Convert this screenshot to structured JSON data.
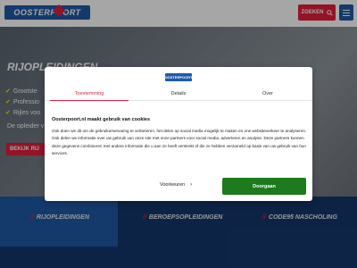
{
  "header": {
    "logo_text": "OOSTERPOORT",
    "search_label": "ZOEKEN"
  },
  "hero": {
    "title": "RIJOPLEIDINGEN",
    "list": [
      "Grootste",
      "Professio",
      "Rijles voo"
    ],
    "text": "De opleider v",
    "button_label": "BEKIJK RIJ"
  },
  "band": {
    "items": [
      "RIJOPLEIDINGEN",
      "BEROEPSOPLEIDINGEN",
      "CODE95 NASCHOLING"
    ]
  },
  "dialog": {
    "logo_text": "OOSTERPOORT",
    "tabs": [
      "Toestemming",
      "Details",
      "Over"
    ],
    "title": "Oosterpoort.nl maakt gebruik van cookies",
    "body": "Ook doen we dit om de gebruikerservaring te verbeteren, het delen op social media mogelijk te maken en ons websiteverkeer te analyseren. Ook delen we informatie over uw gebruik van onze site met onze partners voor social media, adverteren en analyse. Deze partners kunnen deze gegevens combineren met andere informatie die u aan ze heeft verstrekt of die ze hebben verzameld op basis van uw gebruik van hun services.",
    "customize_label": "Voorkeuren",
    "accept_label": "Doorgaan"
  },
  "colors": {
    "brand_blue": "#1f5aa6",
    "brand_red": "#e21e3c",
    "band_navy": "#14376b",
    "accept_green": "#1d7a1d"
  }
}
